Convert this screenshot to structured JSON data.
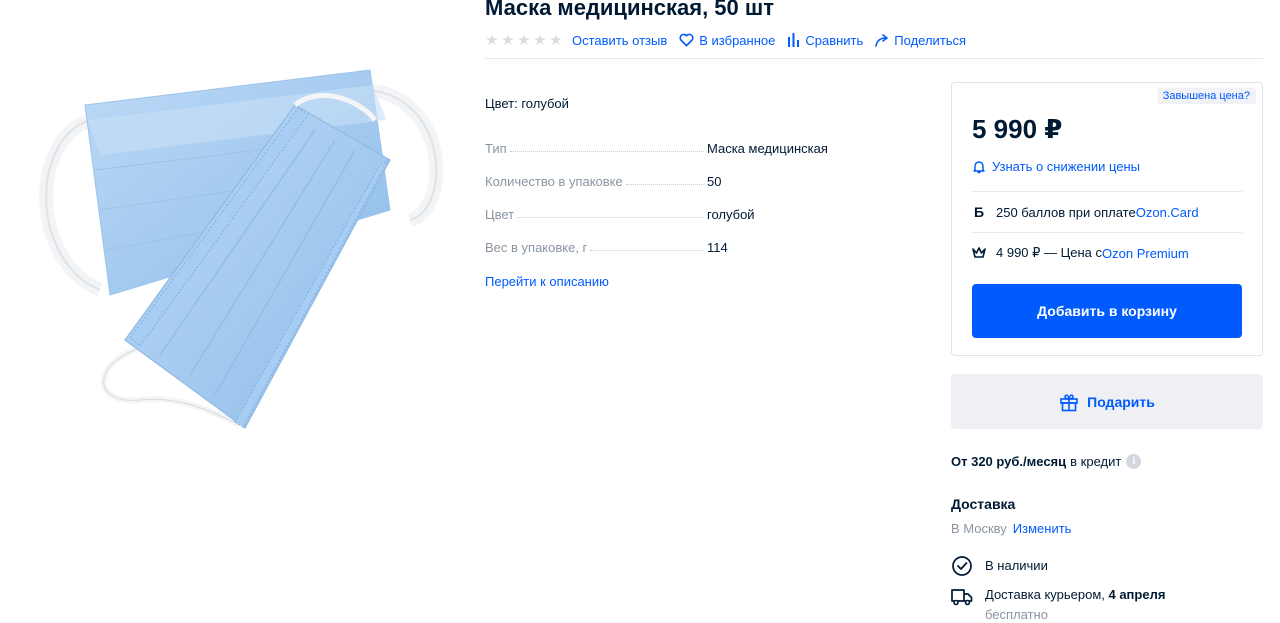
{
  "product": {
    "title": "Маска медицинская, 50 шт",
    "rating_stars": 5
  },
  "meta": {
    "review": "Оставить отзыв",
    "favorite": "В избранное",
    "compare": "Сравнить",
    "share": "Поделиться"
  },
  "specs": {
    "color_line": "Цвет: голубой",
    "rows": [
      {
        "name": "Тип",
        "value": "Маска медицинская"
      },
      {
        "name": "Количество в упаковке",
        "value": "50"
      },
      {
        "name": "Цвет",
        "value": "голубой"
      },
      {
        "name": "Вес в упаковке, г",
        "value": "114"
      }
    ],
    "to_description": "Перейти к описанию"
  },
  "price_card": {
    "overprice": "Завышена цена?",
    "price": "5 990 ₽",
    "price_alert": "Узнать о снижении цены",
    "bonus_text": "250 баллов при оплате ",
    "bonus_link": "Ozon.Card",
    "bonus_icon": "Б",
    "premium_text": "4 990 ₽ — Цена с ",
    "premium_link": "Ozon Premium",
    "add_to_cart": "Добавить в корзину"
  },
  "gift": {
    "label": "Подарить"
  },
  "credit": {
    "amount": "От 320 руб./месяц",
    "suffix": "в кредит",
    "info": "i"
  },
  "delivery": {
    "title": "Доставка",
    "city": "В Москву",
    "change": "Изменить",
    "in_stock": "В наличии",
    "courier_prefix": "Доставка курьером, ",
    "courier_date": "4 апреля",
    "courier_price": "бесплатно"
  },
  "colors": {
    "accent": "#005bff",
    "text": "#001a34",
    "muted": "#8a95a1",
    "mask": "#a8cdf2"
  }
}
